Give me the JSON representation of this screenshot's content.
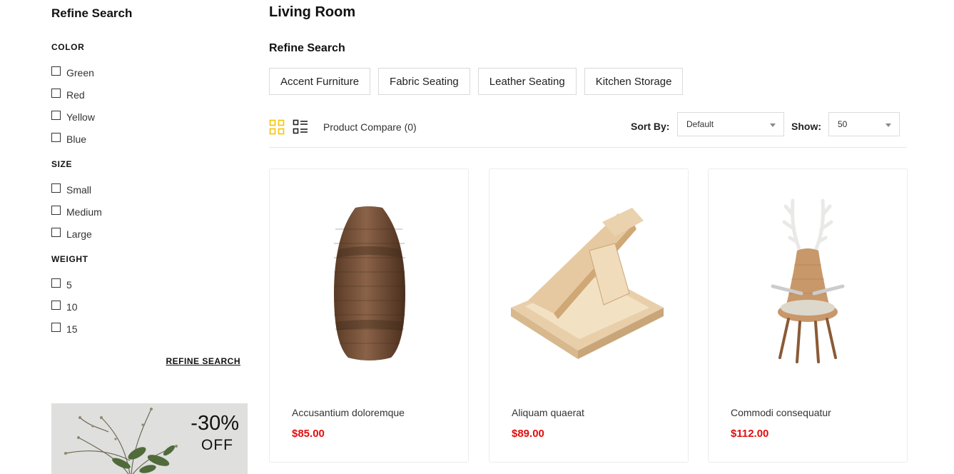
{
  "sidebar": {
    "title": "Refine Search",
    "groups": [
      {
        "title": "COLOR",
        "options": [
          "Green",
          "Red",
          "Yellow",
          "Blue"
        ]
      },
      {
        "title": "SIZE",
        "options": [
          "Small",
          "Medium",
          "Large"
        ]
      },
      {
        "title": "WEIGHT",
        "options": [
          "5",
          "10",
          "15"
        ]
      }
    ],
    "refine_button": "REFINE SEARCH",
    "promo": {
      "discount": "-30%",
      "off": "OFF"
    }
  },
  "main": {
    "title": "Living Room",
    "refine_title": "Refine Search",
    "categories": [
      "Accent Furniture",
      "Fabric Seating",
      "Leather Seating",
      "Kitchen Storage"
    ],
    "toolbar": {
      "compare": "Product Compare (0)",
      "sort_label": "Sort By:",
      "sort_value": "Default",
      "show_label": "Show:",
      "show_value": "50"
    },
    "products": [
      {
        "name": "Accusantium doloremque",
        "price": "$85.00",
        "icon": "wicker-vase"
      },
      {
        "name": "Aliquam quaerat",
        "price": "$89.00",
        "icon": "wooden-tray-stand"
      },
      {
        "name": "Commodi consequatur",
        "price": "$112.00",
        "icon": "antler-wicker-chair"
      }
    ]
  },
  "colors": {
    "accent_icon": "#f5c400",
    "price": "#e20e0e",
    "border": "#ececec"
  }
}
